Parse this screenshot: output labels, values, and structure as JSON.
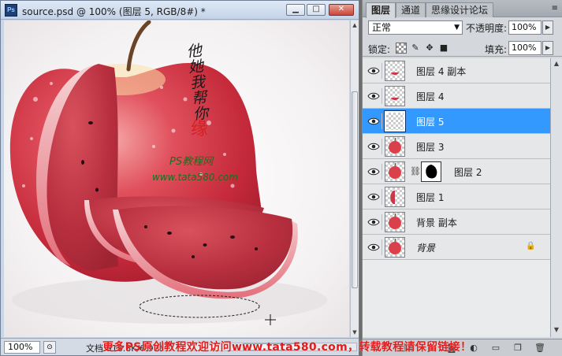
{
  "doc_window": {
    "title": "source.psd @ 100% (图层 5, RGB/8#) *",
    "logo": "Ps",
    "buttons": {
      "minimize": "▁",
      "maximize": "□",
      "close": "✕"
    }
  },
  "canvas": {
    "signature": "他她我帮你",
    "seal": "缘",
    "site_title": "PS教程网",
    "site_url": "www.tata580.com"
  },
  "status_bar": {
    "zoom": "100%",
    "doc_info": "文档:918.8K/6.97M"
  },
  "layers_panel": {
    "tabs": [
      {
        "label": "图层",
        "active": true
      },
      {
        "label": "通道",
        "active": false
      },
      {
        "label": "思缘设计论坛",
        "active": false
      }
    ],
    "blend_mode": "正常",
    "opacity_label": "不透明度:",
    "opacity_value": "100%",
    "lock_label": "锁定:",
    "fill_label": "填充:",
    "fill_value": "100%",
    "layers": [
      {
        "name": "图层 4 副本",
        "visible": true,
        "selected": false,
        "thumb": "slice-small",
        "has_mask": false,
        "italic": false,
        "locked": false
      },
      {
        "name": "图层 4",
        "visible": true,
        "selected": false,
        "thumb": "slice-small",
        "has_mask": false,
        "italic": false,
        "locked": false
      },
      {
        "name": "图层 5",
        "visible": true,
        "selected": true,
        "thumb": "empty",
        "has_mask": false,
        "italic": false,
        "locked": false
      },
      {
        "name": "图层 3",
        "visible": true,
        "selected": false,
        "thumb": "apple",
        "has_mask": false,
        "italic": false,
        "locked": false
      },
      {
        "name": "图层 2",
        "visible": true,
        "selected": false,
        "thumb": "apple",
        "has_mask": true,
        "italic": false,
        "locked": false
      },
      {
        "name": "图层 1",
        "visible": true,
        "selected": false,
        "thumb": "half-slice",
        "has_mask": false,
        "italic": false,
        "locked": false
      },
      {
        "name": "背景 副本",
        "visible": true,
        "selected": false,
        "thumb": "apple",
        "has_mask": false,
        "italic": false,
        "locked": false
      },
      {
        "name": "背景",
        "visible": true,
        "selected": false,
        "thumb": "apple",
        "has_mask": false,
        "italic": true,
        "locked": true
      }
    ]
  },
  "watermark": "更多PS原创教程欢迎访问www.tata580.com，转载教程请保留链接！",
  "colors": {
    "selected_layer": "#3399ff",
    "apple_red": "#d9404a",
    "melon_flesh": "#c9374a",
    "watermark_red": "#e21b1b"
  }
}
